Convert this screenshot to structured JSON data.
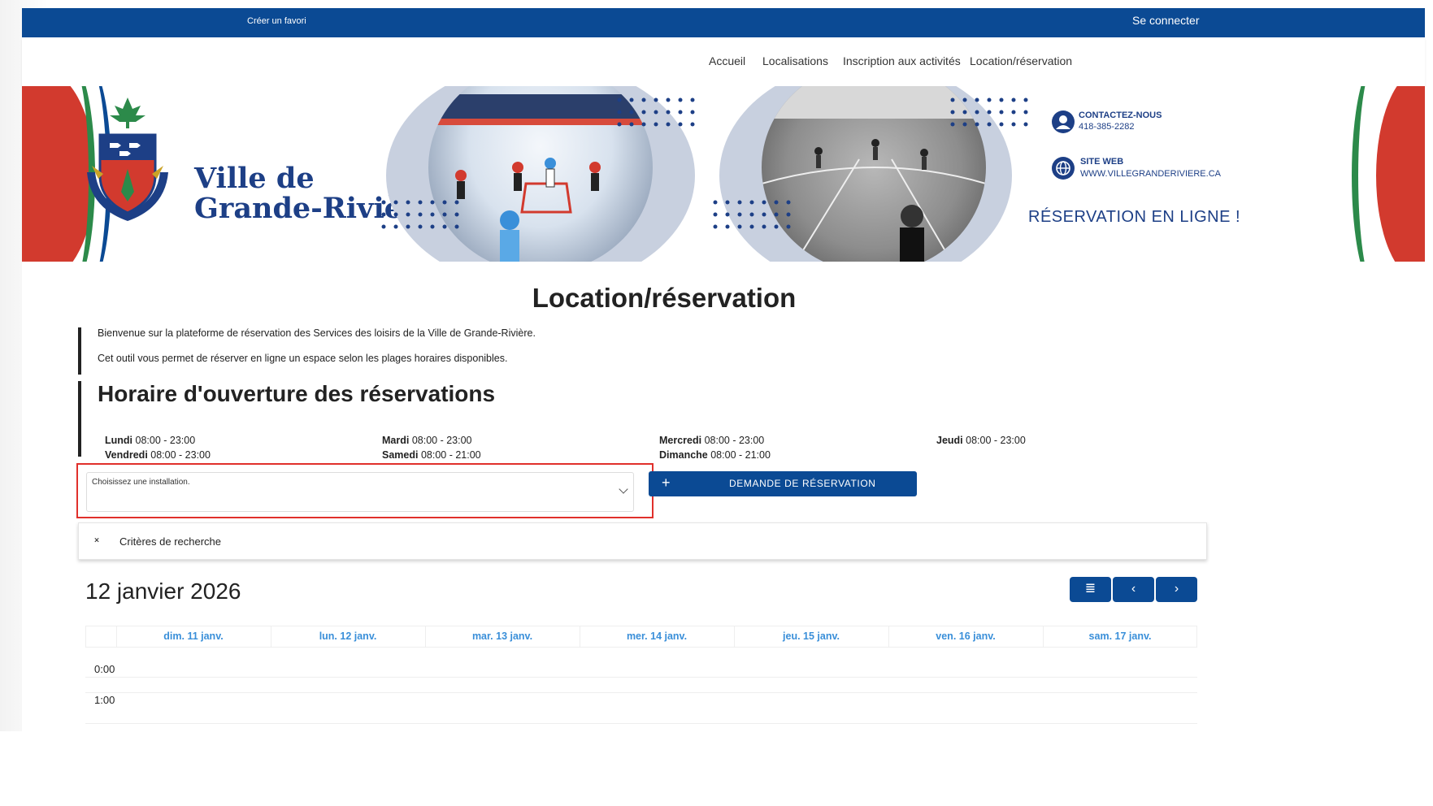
{
  "topbar": {
    "favorite": "Créer un favori",
    "login": "Se connecter"
  },
  "nav": {
    "items": [
      "Accueil",
      "Localisations",
      "Inscription aux activités",
      "Location/réservation"
    ]
  },
  "banner": {
    "logo_line1": "Ville de",
    "logo_line2": "Grande-Rivière",
    "contact_title": "CONTACTEZ-NOUS",
    "contact_phone": "418-385-2282",
    "web_title": "SITE WEB",
    "web_url": "WWW.VILLEGRANDERIVIERE.CA",
    "reserve_line": "RÉSERVATION EN LIGNE !"
  },
  "main": {
    "title": "Location/réservation",
    "intro": [
      "Bienvenue sur la plateforme de réservation des Services des loisirs de la Ville de Grande-Rivière.",
      "Cet outil vous permet de réserver en ligne un espace selon les plages horaires disponibles."
    ],
    "hours_title": "Horaire d'ouverture des réservations",
    "hours": [
      {
        "day": "Lundi",
        "time": "08:00 - 23:00"
      },
      {
        "day": "Mardi",
        "time": "08:00 - 23:00"
      },
      {
        "day": "Mercredi",
        "time": "08:00 - 23:00"
      },
      {
        "day": "Jeudi",
        "time": "08:00 - 23:00"
      },
      {
        "day": "Vendredi",
        "time": "08:00 - 23:00"
      },
      {
        "day": "Samedi",
        "time": "08:00 - 21:00"
      },
      {
        "day": "Dimanche",
        "time": "08:00 - 21:00"
      }
    ],
    "select_label": "Choisissez une installation.",
    "demand_button": "DEMANDE DE RÉSERVATION",
    "criteria_label": "Critères de recherche",
    "calendar_date": "12 janvier 2026",
    "cal_buttons": {
      "list": "≣",
      "prev": "‹",
      "next": "›"
    },
    "calendar_days": [
      "dim. 11 janv.",
      "lun. 12 janv.",
      "mar. 13 janv.",
      "mer. 14 janv.",
      "jeu. 15 janv.",
      "ven. 16 janv.",
      "sam. 17 janv."
    ],
    "calendar_times": [
      "0:00",
      "1:00"
    ]
  },
  "colors": {
    "brand_blue": "#0b4a94",
    "highlight_red": "#e0302b",
    "day_header": "#3a8fd9"
  }
}
